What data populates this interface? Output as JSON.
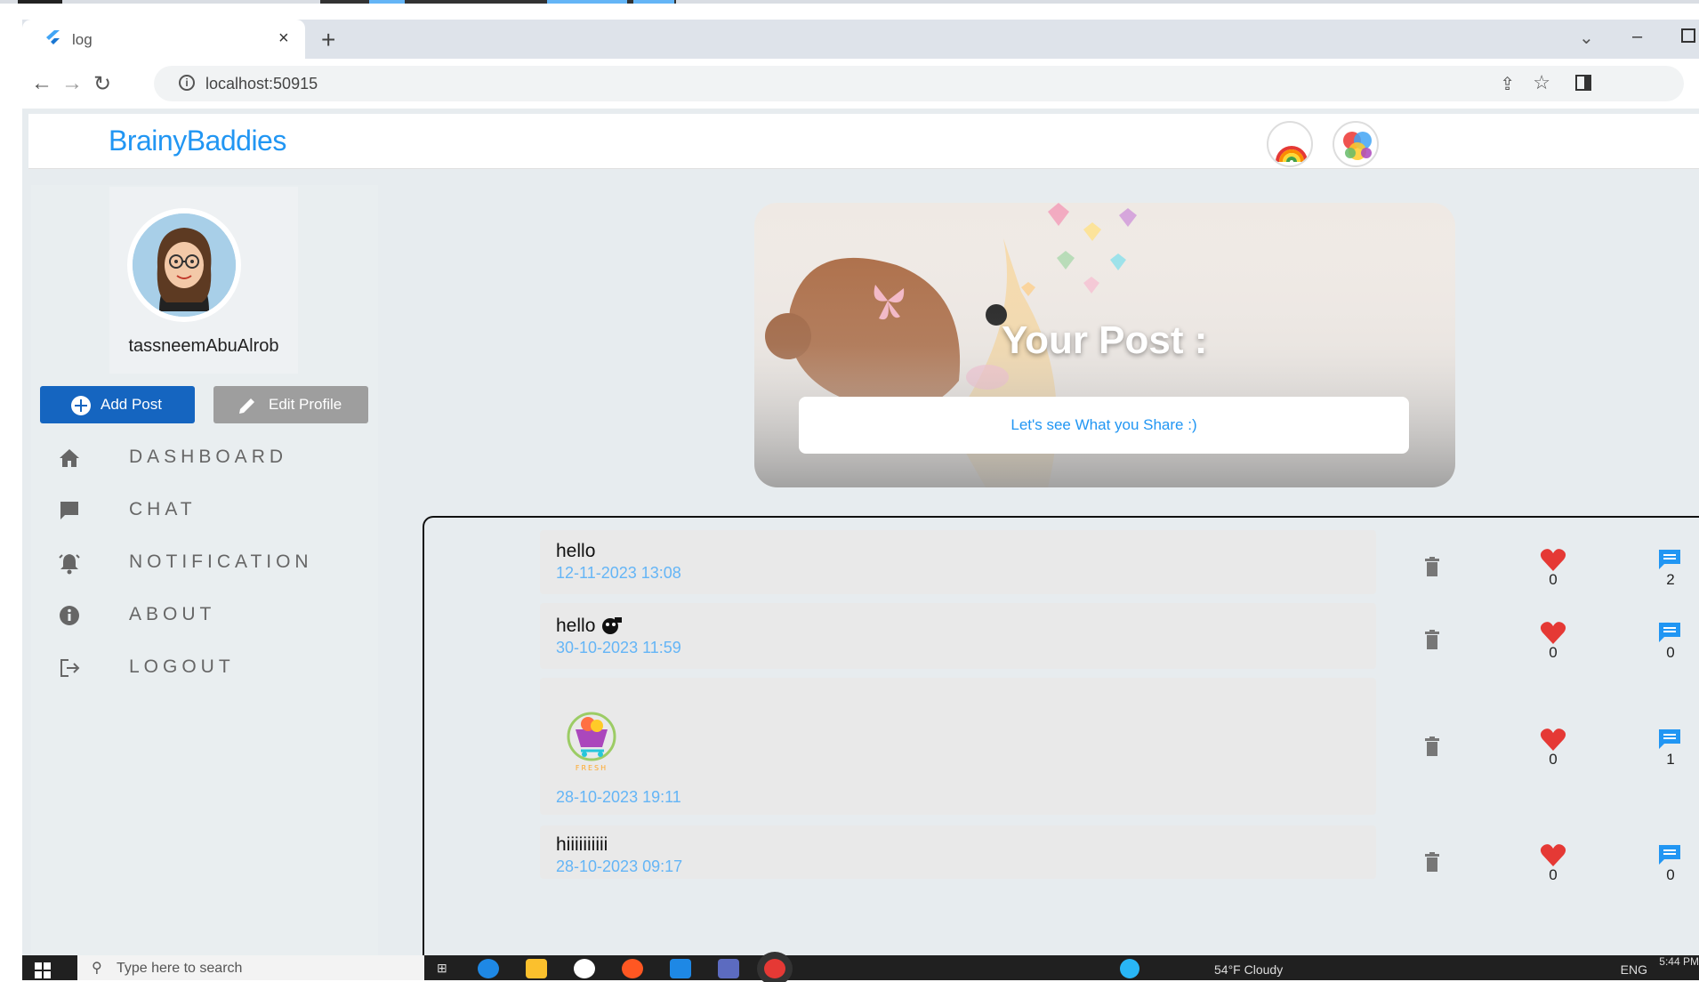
{
  "browser": {
    "tab_title": "log",
    "url": "localhost:50915",
    "new_tab_glyph": "+",
    "close_glyph": "×"
  },
  "app": {
    "brand": "BrainyBaddies",
    "colors": {
      "brand": "#2196f3",
      "primary": "#1565c0",
      "heart": "#e53935",
      "date": "#64b5f6"
    }
  },
  "sidebar": {
    "username": "tassneemAbuAlrob",
    "add_post": "Add Post",
    "edit_profile": "Edit Profile",
    "items": [
      {
        "label": "DASHBOARD",
        "icon": "home-icon"
      },
      {
        "label": "CHAT",
        "icon": "chat-icon"
      },
      {
        "label": "NOTIFICATION",
        "icon": "notification-icon"
      },
      {
        "label": "ABOUT",
        "icon": "info-icon"
      },
      {
        "label": "LOGOUT",
        "icon": "logout-icon"
      }
    ]
  },
  "hero": {
    "title": "Your Post :",
    "input_placeholder": "Let's see What you Share :)"
  },
  "posts": [
    {
      "text": "hello",
      "date": "12-11-2023 13:08",
      "likes": "0",
      "comments": "2"
    },
    {
      "text": "hello",
      "date": "30-10-2023 11:59",
      "likes": "0",
      "comments": "0"
    },
    {
      "text": "",
      "date": "28-10-2023 19:11",
      "likes": "0",
      "comments": "1",
      "image_caption": "FRESH"
    },
    {
      "text": "hiiiiiiiiii",
      "date": "28-10-2023 09:17",
      "likes": "0",
      "comments": "0"
    }
  ],
  "taskbar": {
    "search_placeholder": "Type here to search",
    "weather": "54°F Cloudy",
    "lang": "ENG",
    "time": "5:44 PM"
  }
}
